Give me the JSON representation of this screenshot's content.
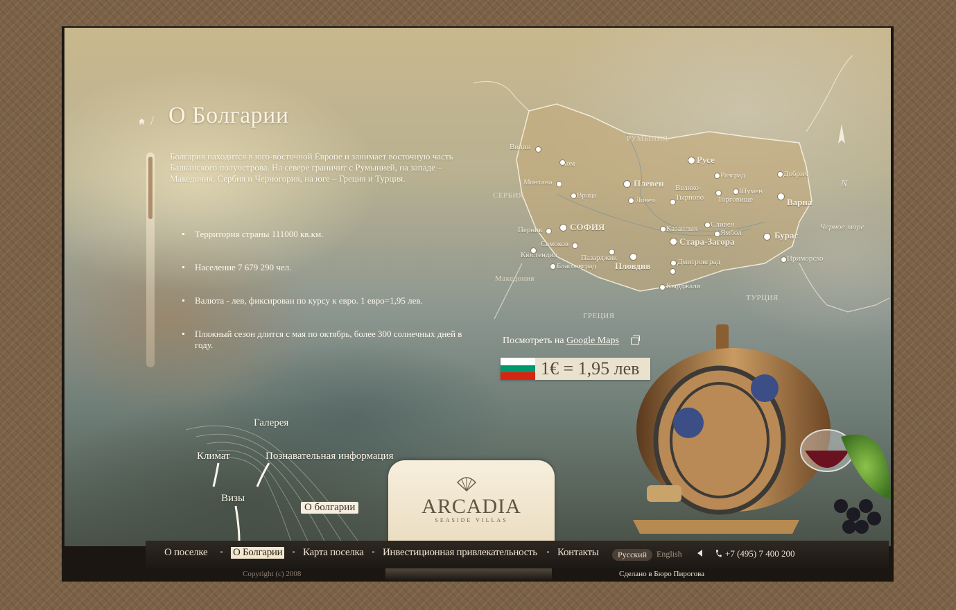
{
  "page": {
    "title": "О Болгарии",
    "intro": "Болгария находится в юго-восточной Европе и занимает восточную часть Балканского полуострова. На севере граничит с Румынией, на западе – Македония, Сербия и Черногория, на юге – Греция и Турция.",
    "facts": [
      "Территория страны 111000 кв.км.",
      "Население 7 679 290 чел.",
      "Валюта - лев, фиксирован по курсу к евро. 1 евро=1,95 лев.",
      "Пляжный сезон длится с мая по октябрь, более 300 солнечных дней в году."
    ]
  },
  "map": {
    "countries": [
      "РУМЫНИЯ",
      "СЕРБИЯ",
      "Македония",
      "ГРЕЦИЯ",
      "ТУРЦИЯ"
    ],
    "sea": "Черное море",
    "compass": "N",
    "cities": [
      {
        "name": "Видин"
      },
      {
        "name": "Лом"
      },
      {
        "name": "Русе"
      },
      {
        "name": "Добрич"
      },
      {
        "name": "Плевен"
      },
      {
        "name": "Разград"
      },
      {
        "name": "Монтана"
      },
      {
        "name": "Враца"
      },
      {
        "name": "Велико-Тырново"
      },
      {
        "name": "Шумен"
      },
      {
        "name": "Ловеч"
      },
      {
        "name": "Торговище"
      },
      {
        "name": "Варна"
      },
      {
        "name": "Перник"
      },
      {
        "name": "СОФИЯ"
      },
      {
        "name": "Казанлык"
      },
      {
        "name": "Сливен"
      },
      {
        "name": "Ямбол"
      },
      {
        "name": "Бурас"
      },
      {
        "name": "Самоков"
      },
      {
        "name": "Стара-Загора"
      },
      {
        "name": "Кюстендил"
      },
      {
        "name": "Пазарджик"
      },
      {
        "name": "Приморско"
      },
      {
        "name": "Благоевград"
      },
      {
        "name": "Пловдив"
      },
      {
        "name": "Дмитровград"
      },
      {
        "name": "Кырджали"
      }
    ],
    "maps_prefix": "Посмотреть на",
    "maps_link": "Google Maps"
  },
  "rate": {
    "text": "1€ = 1,95 лев"
  },
  "fan_menu": {
    "gallery": "Галерея",
    "climate": "Климат",
    "info": "Познавательная информация",
    "visas": "Визы",
    "about": "О болгарии"
  },
  "logo": {
    "name": "ARCADIA",
    "sub": "SEASIDE VILLAS"
  },
  "nav": {
    "items": [
      "О поселке",
      "О Болгарии",
      "Карта поселка",
      "Инвестиционная привлекательность",
      "Контакты"
    ],
    "lang_ru": "Русский",
    "lang_en": "English",
    "phone": "+7 (495) 7 400 200"
  },
  "footer": {
    "copyright": "Copyright (c) 2008",
    "madeby": "Сделано в Бюро Пирогова"
  },
  "colors": {
    "accent": "#f2e7cf",
    "frame": "#7b6246",
    "flag_white": "#ffffff",
    "flag_green": "#00966e",
    "flag_red": "#d62612"
  }
}
